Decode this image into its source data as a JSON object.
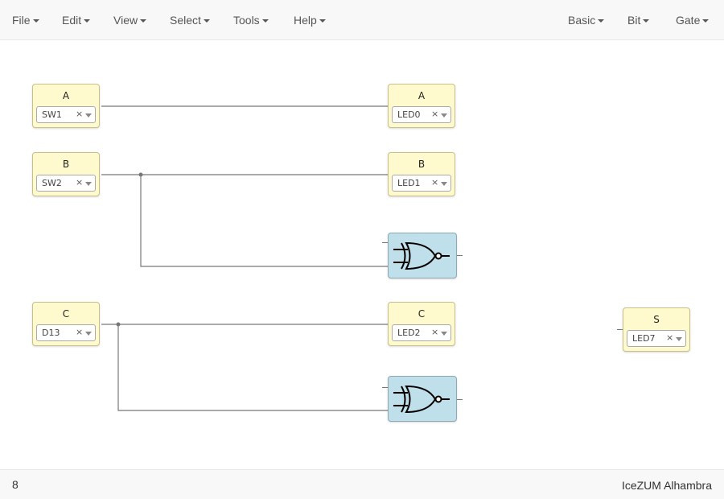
{
  "menubar": {
    "left": [
      {
        "label": "File"
      },
      {
        "label": "Edit"
      },
      {
        "label": "View"
      },
      {
        "label": "Select"
      },
      {
        "label": "Tools"
      },
      {
        "label": "Help"
      }
    ],
    "right": [
      {
        "label": "Basic"
      },
      {
        "label": "Bit"
      },
      {
        "label": "Gate"
      }
    ]
  },
  "canvas": {
    "inputs": [
      {
        "name": "A",
        "pin": "SW1"
      },
      {
        "name": "B",
        "pin": "SW2"
      },
      {
        "name": "C",
        "pin": "D13"
      }
    ],
    "outputs": [
      {
        "name": "A",
        "pin": "LED0"
      },
      {
        "name": "B",
        "pin": "LED1"
      },
      {
        "name": "C",
        "pin": "LED2"
      },
      {
        "name": "S",
        "pin": "LED7"
      }
    ],
    "gates": [
      {
        "type": "xnor-gate"
      },
      {
        "type": "xnor-gate"
      }
    ],
    "clear_symbol": "×"
  },
  "footer": {
    "left_text": "8",
    "board": "IceZUM Alhambra"
  },
  "colors": {
    "io_block": "#fffacd",
    "gate_block": "#bfdfea",
    "wire": "#777777"
  }
}
